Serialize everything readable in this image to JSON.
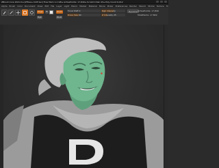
{
  "window": {
    "title": "ZBrush Core 2021.6 ▸ [ZFiles ▸ 0.08 Sec] Free Mem 1.2 GB ▸ ActivePoints: 17,849 ▸ Scratch Disk 43 ▸ Poly Count 6,012",
    "controls": [
      "minimize",
      "maximize",
      "close"
    ]
  },
  "menubar": {
    "items": [
      "Alpha",
      "Brush",
      "Color",
      "Document",
      "Draw",
      "Edit",
      "File",
      "Layer",
      "Light",
      "Macro",
      "Marker",
      "Material",
      "Movie",
      "Picker",
      "Preferences",
      "Render",
      "Stencil",
      "Stroke",
      "Texture",
      "Tool",
      "Transform",
      "Zplugin",
      "Zscript",
      "Help"
    ]
  },
  "toolbar": {
    "buttons": [
      {
        "name": "edit",
        "icon": "brush-icon",
        "active": false
      },
      {
        "name": "draw",
        "icon": "pencil-icon",
        "active": false
      },
      {
        "name": "move",
        "icon": "move-icon",
        "active": false
      },
      {
        "name": "scale",
        "icon": "scale-icon",
        "active": true
      },
      {
        "name": "rotate",
        "icon": "rotate-icon",
        "active": false
      }
    ],
    "mrgb_label": "Mrgb",
    "rgb_label": "Rgb",
    "m_label": "M",
    "zadd_label": "Zadd",
    "zsub_label": "Zsub",
    "focal_label": "Focal Shift 0",
    "draw_size_label": "Draw Size 64",
    "rgb_intensity_label": "Rgb Intensity",
    "z_intensity_label": "Z Intensity 25",
    "dynamic_label": "Dynamic",
    "active_points_label": "ActivePoints: 17,849",
    "total_points_label": "TotalPoints: 17,849",
    "accent_color": "#d06a18"
  },
  "viewport": {
    "subject": "3D sculpt of a stylized character with green face and black shirt with emblem",
    "emblem_text": "D",
    "skin_color": "#6fb58e",
    "hair_color": "#bcbcbc",
    "shirt_color": "#1c1c1c"
  }
}
